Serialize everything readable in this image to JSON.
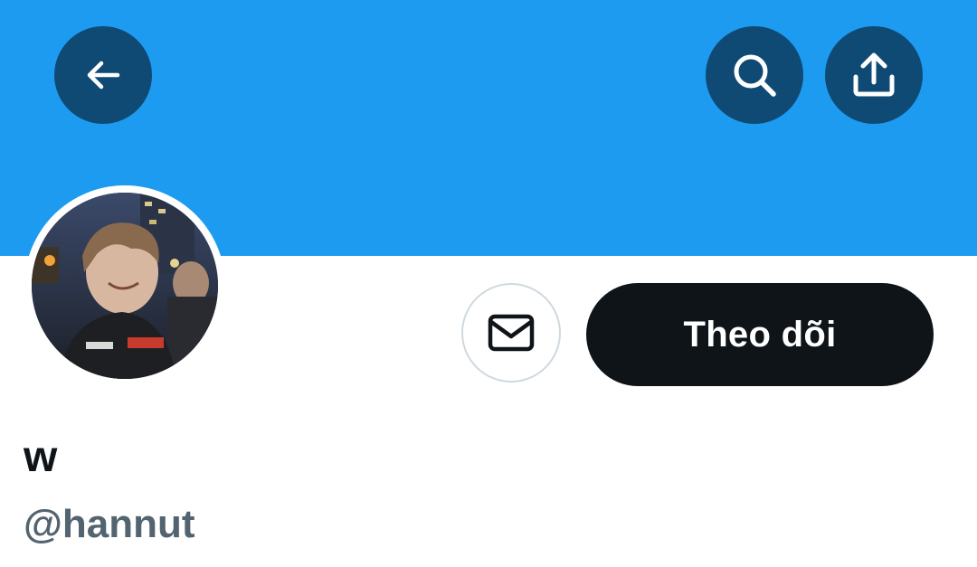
{
  "header": {
    "banner_color": "#1d9bf0",
    "buttons": [
      {
        "name": "back-button",
        "icon": "arrow-left-icon"
      },
      {
        "name": "search-button",
        "icon": "search-icon"
      },
      {
        "name": "share-button",
        "icon": "share-upload-icon"
      }
    ]
  },
  "profile": {
    "avatar_icon": "avatar-photo",
    "display_name": "w",
    "handle": "@hannut"
  },
  "actions": {
    "message_icon": "envelope-icon",
    "follow_label": "Theo dõi"
  },
  "colors": {
    "accent": "#1d9bf0",
    "button_dark": "#0f4a75",
    "follow_bg": "#0f1419",
    "handle_text": "#536471"
  }
}
